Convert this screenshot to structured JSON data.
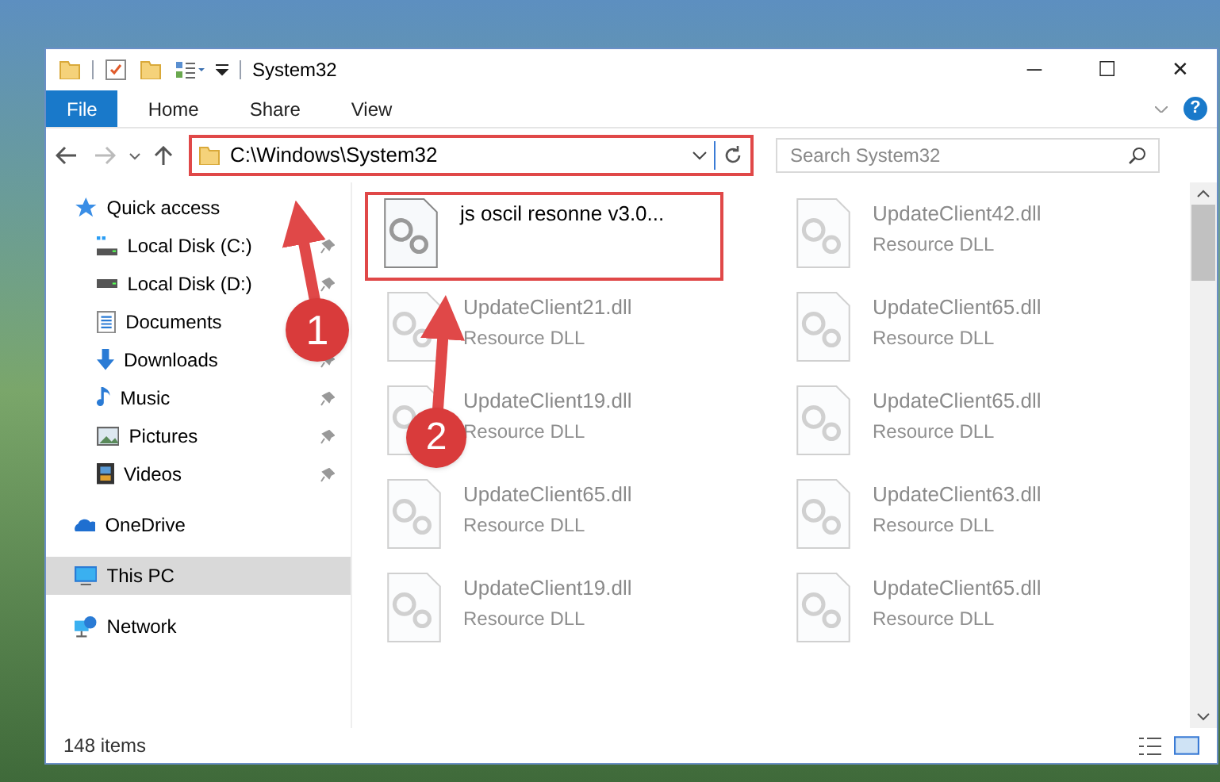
{
  "window": {
    "title": "System32",
    "controls": [
      "─",
      "☐",
      "✕"
    ]
  },
  "ribbon": {
    "tabs": [
      {
        "label": "File",
        "selected": true
      },
      {
        "label": "Home",
        "selected": false
      },
      {
        "label": "Share",
        "selected": false
      },
      {
        "label": "View",
        "selected": false
      }
    ],
    "help": "?"
  },
  "address_bar": {
    "path": "C:\\Windows\\System32",
    "highlighted": true
  },
  "search": {
    "placeholder": "Search System32"
  },
  "sidebar": {
    "items": [
      {
        "label": "Quick access",
        "selected": false,
        "children": [
          {
            "label": "Local Disk (C:)",
            "pinned": true,
            "selected": false
          },
          {
            "label": "Local Disk (D:)",
            "pinned": true,
            "selected": false
          },
          {
            "label": "Documents",
            "pinned": false,
            "selected": false
          },
          {
            "label": "Downloads",
            "pinned": true,
            "selected": false
          },
          {
            "label": "Music",
            "pinned": true,
            "selected": false
          },
          {
            "label": "Pictures",
            "pinned": true,
            "selected": false
          },
          {
            "label": "Videos",
            "pinned": true,
            "selected": false
          }
        ]
      },
      {
        "label": "OneDrive",
        "selected": false
      },
      {
        "label": "This PC",
        "selected": true
      },
      {
        "label": "Network",
        "selected": false
      }
    ]
  },
  "files": [
    {
      "name": "js oscil resonne v3.0...",
      "blurred": false,
      "highlighted": true
    },
    {
      "name": "UpdateClient42.dll",
      "type": "Resource DLL",
      "blurred": true,
      "highlighted": false
    },
    {
      "name": "UpdateClient21.dll",
      "type": "Resource DLL",
      "blurred": true,
      "highlighted": false
    },
    {
      "name": "UpdateClient65.dll",
      "type": "Resource DLL",
      "blurred": true,
      "highlighted": false
    },
    {
      "name": "UpdateClient19.dll",
      "type": "Resource DLL",
      "blurred": true,
      "highlighted": false
    },
    {
      "name": "UpdateClient65.dll",
      "type": "Resource DLL",
      "blurred": true,
      "highlighted": false
    },
    {
      "name": "UpdateClient65.dll",
      "type": "Resource DLL",
      "blurred": true,
      "highlighted": false
    },
    {
      "name": "UpdateClient63.dll",
      "type": "Resource DLL",
      "blurred": true,
      "highlighted": false
    },
    {
      "name": "UpdateClient19.dll",
      "type": "Resource DLL",
      "blurred": true,
      "highlighted": false
    },
    {
      "name": "UpdateClient65.dll",
      "type": "Resource DLL",
      "blurred": true,
      "highlighted": false
    }
  ],
  "status_bar": {
    "count": "148 items"
  },
  "callouts": [
    {
      "label": "1"
    },
    {
      "label": "2"
    }
  ]
}
